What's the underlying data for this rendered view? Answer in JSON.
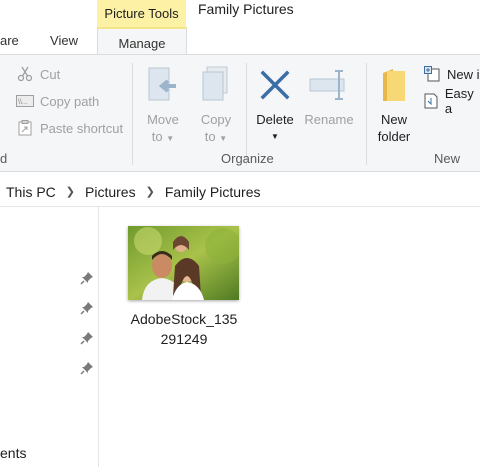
{
  "window": {
    "title": "Family Pictures"
  },
  "contextual_tab_group": {
    "label": "Picture Tools"
  },
  "tabs": [
    {
      "label": "are"
    },
    {
      "label": "View"
    },
    {
      "label": "Manage"
    }
  ],
  "ribbon": {
    "clipboard": {
      "cut": "Cut",
      "copy_path": "Copy path",
      "paste_shortcut": "Paste shortcut",
      "group_label": "d"
    },
    "organize": {
      "move_to": "Move\nto",
      "move_to_line1": "Move",
      "move_to_line2": "to",
      "copy_to_line1": "Copy",
      "copy_to_line2": "to",
      "delete": "Delete",
      "rename": "Rename",
      "group_label": "Organize"
    },
    "new": {
      "new_folder_line1": "New",
      "new_folder_line2": "folder",
      "new_item": "New i",
      "easy_access": "Easy a",
      "group_label": "New"
    }
  },
  "address_bar": {
    "crumbs": [
      "This PC",
      "Pictures",
      "Family Pictures"
    ]
  },
  "nav": {
    "partial_item": "ents"
  },
  "files": [
    {
      "name_line1": "AdobeStock_135",
      "name_line2": "291249"
    }
  ],
  "colors": {
    "contextual_tab": "#fdf1a6",
    "ribbon_bg": "#f5f6f7",
    "delete_x": "#3b6ea5",
    "folder": "#f8d775"
  }
}
